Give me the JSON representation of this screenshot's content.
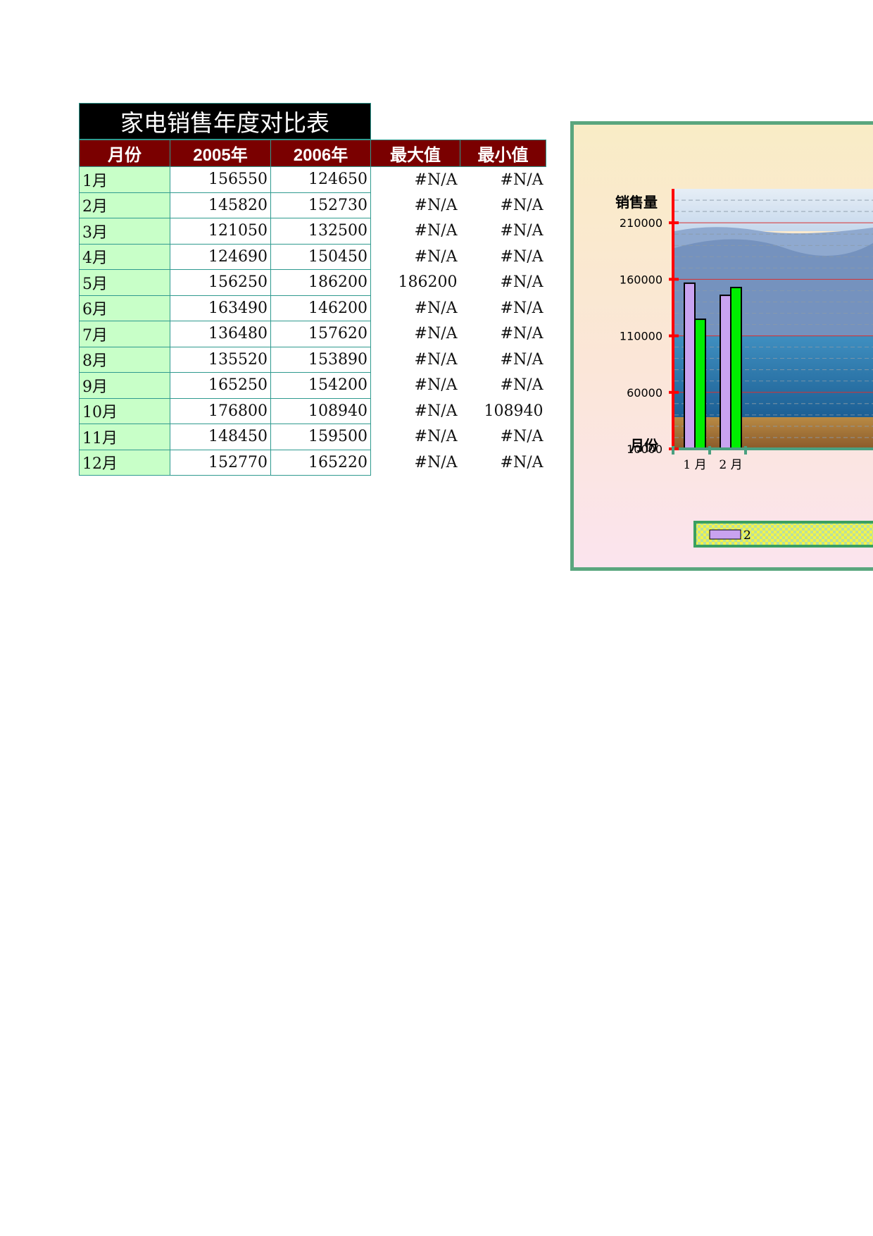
{
  "title": "家电销售年度对比表",
  "columns": [
    "月份",
    "2005年",
    "2006年",
    "最大值",
    "最小值"
  ],
  "rows": [
    [
      "1月",
      "156550",
      "124650",
      "#N/A",
      "#N/A"
    ],
    [
      "2月",
      "145820",
      "152730",
      "#N/A",
      "#N/A"
    ],
    [
      "3月",
      "121050",
      "132500",
      "#N/A",
      "#N/A"
    ],
    [
      "4月",
      "124690",
      "150450",
      "#N/A",
      "#N/A"
    ],
    [
      "5月",
      "156250",
      "186200",
      "186200",
      "#N/A"
    ],
    [
      "6月",
      "163490",
      "146200",
      "#N/A",
      "#N/A"
    ],
    [
      "7月",
      "136480",
      "157620",
      "#N/A",
      "#N/A"
    ],
    [
      "8月",
      "135520",
      "153890",
      "#N/A",
      "#N/A"
    ],
    [
      "9月",
      "165250",
      "154200",
      "#N/A",
      "#N/A"
    ],
    [
      "10月",
      "176800",
      "108940",
      "#N/A",
      "108940"
    ],
    [
      "11月",
      "148450",
      "159500",
      "#N/A",
      "#N/A"
    ],
    [
      "12月",
      "152770",
      "165220",
      "#N/A",
      "#N/A"
    ]
  ],
  "chart_data": {
    "type": "bar",
    "ylabel": "销售量",
    "xlabel": "月份",
    "yticks": [
      "210000",
      "160000",
      "110000",
      "60000",
      "10000"
    ],
    "ylim": [
      10000,
      240000
    ],
    "categories": [
      "1 月",
      "2 月"
    ],
    "series": [
      {
        "values": [
          156550,
          145820
        ],
        "color": "#c9a3f0"
      },
      {
        "values": [
          124650,
          152730
        ],
        "color": "#00ee00"
      }
    ],
    "legend_text": "2"
  }
}
